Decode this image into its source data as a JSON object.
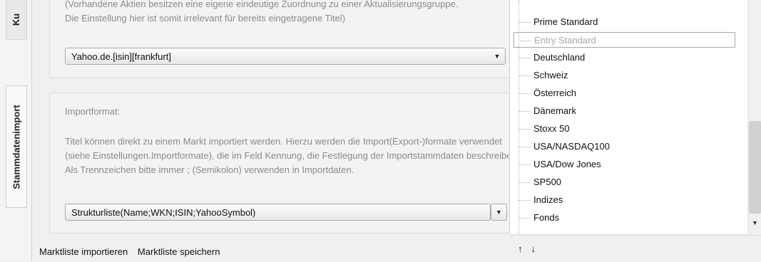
{
  "side_tabs": [
    {
      "label": "Ku"
    },
    {
      "label": "Stammdatenimport"
    }
  ],
  "update_group": {
    "info_text": "(Vorhandene Aktien besitzen eine eigene eindeutige Zuordnung zu einer Aktualisierungsgruppe. Die Einstellung hier ist somit irrelevant für bereits eingetragene Titel)",
    "dropdown_value": "Yahoo.de.[isin][frankfurt]"
  },
  "import_group": {
    "label": "Importformat:",
    "info_text": "Titel können direkt zu einem Markt importiert werden. Hierzu werden die Import(Export-)formate verwendet (siehe Einstellungen.Importformate), die im Feld Kennung, die Festlegung der Importstammdaten beschreiben. Als Trennzeichen bitte immer ; (Semikolon) verwenden in Importdaten.",
    "dropdown_value": "Strukturliste(Name;WKN;ISIN;YahooSymbol)"
  },
  "links": {
    "import": "Marktliste importieren",
    "save": "Marktliste speichern"
  },
  "market_list": {
    "items": [
      {
        "label": "Prime Standard",
        "selected": false
      },
      {
        "label": "Entry Standard",
        "selected": true
      },
      {
        "label": "Deutschland",
        "selected": false
      },
      {
        "label": "Schweiz",
        "selected": false
      },
      {
        "label": "Österreich",
        "selected": false
      },
      {
        "label": "Dänemark",
        "selected": false
      },
      {
        "label": "Stoxx 50",
        "selected": false
      },
      {
        "label": "USA/NASDAQ100",
        "selected": false
      },
      {
        "label": "USA/Dow Jones",
        "selected": false
      },
      {
        "label": "SP500",
        "selected": false
      },
      {
        "label": "Indizes",
        "selected": false
      },
      {
        "label": "Fonds",
        "selected": false
      }
    ]
  },
  "sort_buttons": {
    "up": "↑",
    "down": "↓"
  },
  "icons": {
    "dropdown_arrow": "▼",
    "scroll_down": "▼"
  }
}
